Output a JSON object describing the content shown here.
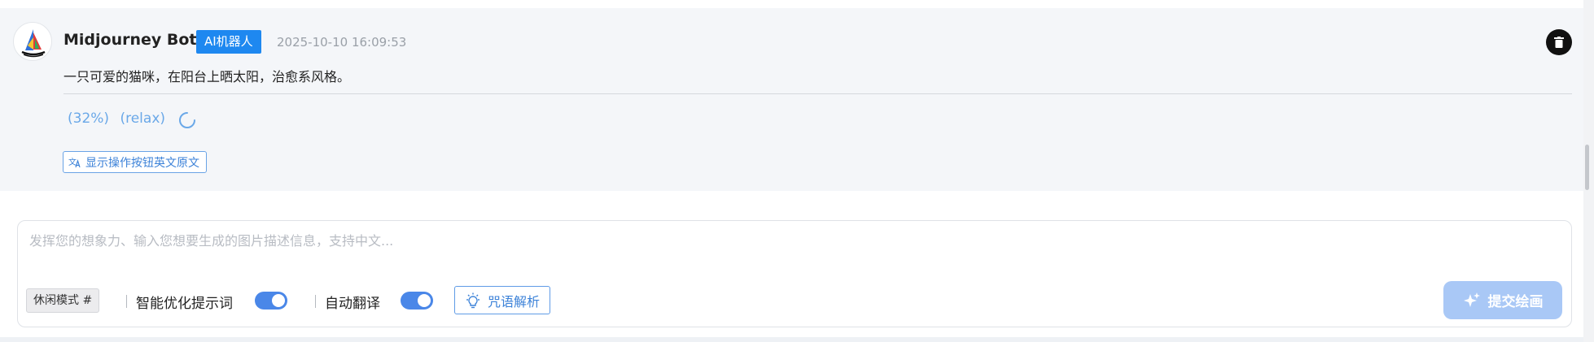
{
  "message": {
    "sender": "Midjourney Bot",
    "badge": "AI机器人",
    "timestamp": "2025-10-10 16:09:53",
    "text": "一只可爱的猫咪，在阳台上晒太阳，治愈系风格。",
    "progress": "(32%)",
    "mode": "(relax)",
    "show_button": "显示操作按钮英文原文",
    "icons": {
      "avatar": "midjourney-sailboat-logo",
      "delete": "trash-icon",
      "loading": "spinner-icon",
      "translate": "translate-icon"
    }
  },
  "composer": {
    "placeholder": "发挥您的想象力、输入您想要生成的图片描述信息，支持中文...",
    "value": "",
    "mode_button": "休闲模式 #",
    "options": [
      {
        "label": "智能优化提示词",
        "enabled": true
      },
      {
        "label": "自动翻译",
        "enabled": true
      }
    ],
    "parse_button": "咒语解析",
    "submit_button": "提交绘画",
    "icons": {
      "parse": "lightbulb-icon",
      "submit": "sparkle-icon"
    }
  },
  "colors": {
    "accent": "#1e88f0",
    "toggle_on": "#4a87e8",
    "submit_bg": "#a9c8f6",
    "progress_text": "#6aa8e8"
  }
}
